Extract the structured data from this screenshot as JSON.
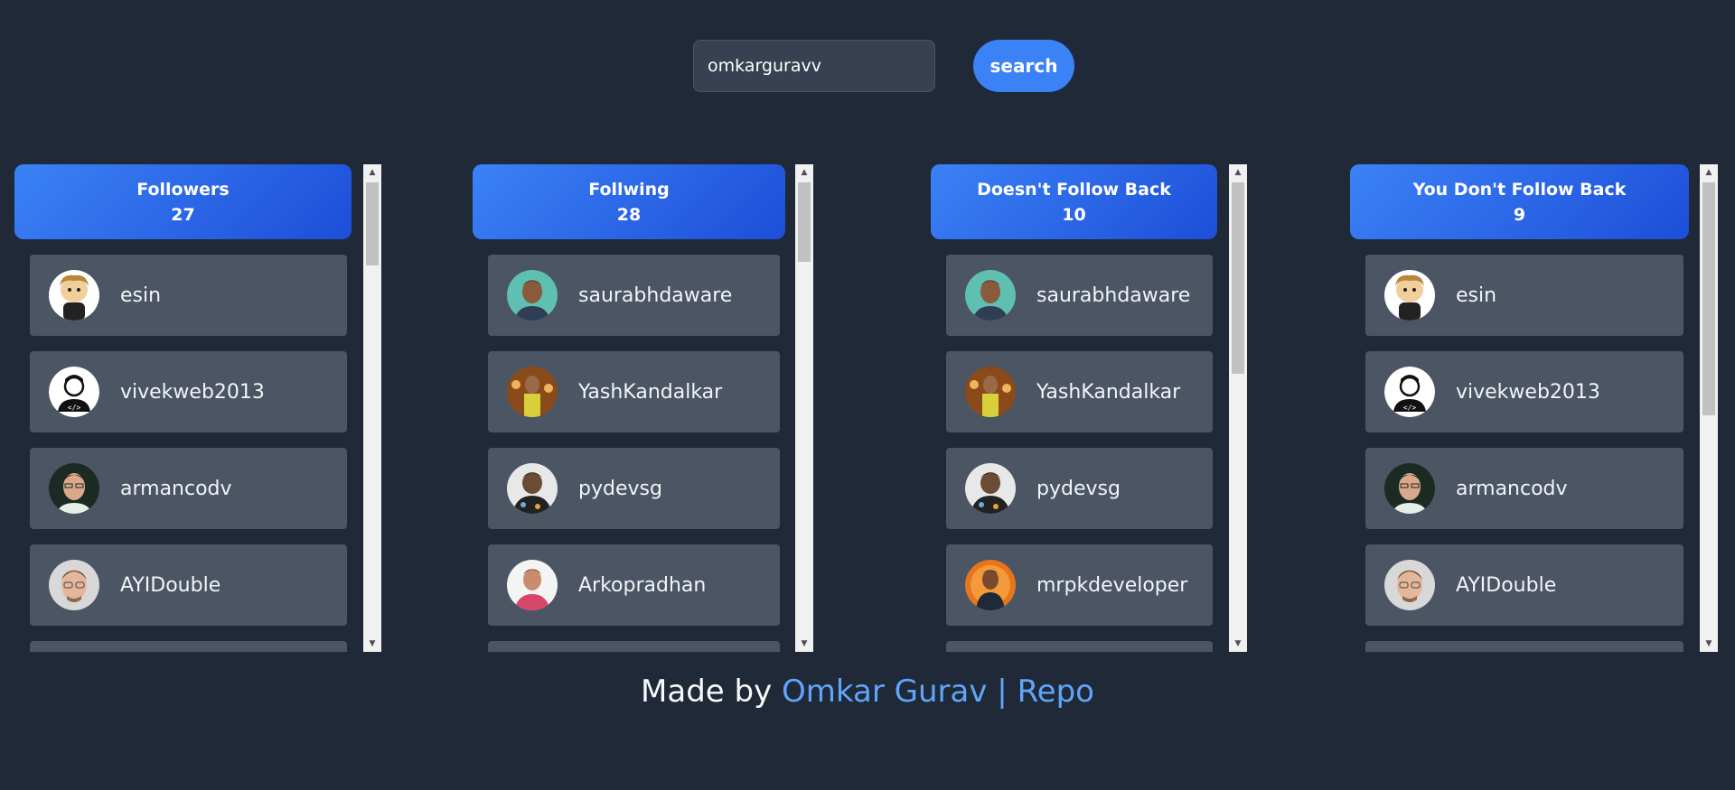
{
  "search": {
    "value": "omkarguravv",
    "button_label": "search"
  },
  "columns": [
    {
      "title": "Followers",
      "count": "27",
      "users": [
        {
          "name": "esin",
          "avatar": "cartoon-avatar"
        },
        {
          "name": "vivekweb2013",
          "avatar": "developer-icon-avatar"
        },
        {
          "name": "armancodv",
          "avatar": "photo-avatar"
        },
        {
          "name": "AYIDouble",
          "avatar": "photo-avatar"
        }
      ]
    },
    {
      "title": "Follwing",
      "count": "28",
      "users": [
        {
          "name": "saurabhdaware",
          "avatar": "photo-avatar"
        },
        {
          "name": "YashKandalkar",
          "avatar": "photo-avatar"
        },
        {
          "name": "pydevsg",
          "avatar": "photo-avatar"
        },
        {
          "name": "Arkopradhan",
          "avatar": "photo-avatar"
        }
      ]
    },
    {
      "title": "Doesn't Follow Back",
      "count": "10",
      "users": [
        {
          "name": "saurabhdaware",
          "avatar": "photo-avatar"
        },
        {
          "name": "YashKandalkar",
          "avatar": "photo-avatar"
        },
        {
          "name": "pydevsg",
          "avatar": "photo-avatar"
        },
        {
          "name": "mrpkdeveloper",
          "avatar": "photo-avatar"
        }
      ]
    },
    {
      "title": "You Don't Follow Back",
      "count": "9",
      "users": [
        {
          "name": "esin",
          "avatar": "cartoon-avatar"
        },
        {
          "name": "vivekweb2013",
          "avatar": "developer-icon-avatar"
        },
        {
          "name": "armancodv",
          "avatar": "photo-avatar"
        },
        {
          "name": "AYIDouble",
          "avatar": "photo-avatar"
        }
      ]
    }
  ],
  "footer": {
    "prefix": "Made by",
    "author_link": "Omkar Gurav",
    "separator": "|",
    "repo_link": "Repo"
  },
  "colors": {
    "background": "#1f2937",
    "accent": "#3b82f6",
    "card": "#4b5563",
    "link": "#60a5fa"
  }
}
